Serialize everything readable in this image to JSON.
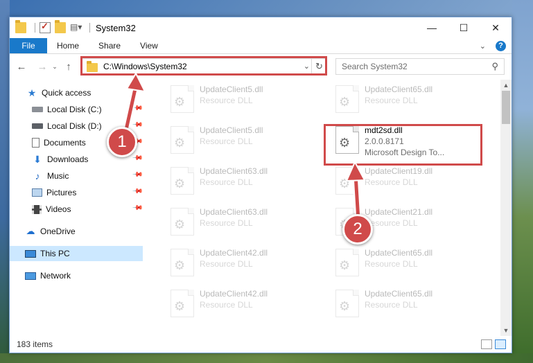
{
  "window": {
    "title": "System32",
    "controls": {
      "minimize": "—",
      "maximize": "☐",
      "close": "✕"
    }
  },
  "ribbon": {
    "tabs": [
      "File",
      "Home",
      "Share",
      "View"
    ],
    "help": "?"
  },
  "address": {
    "path": "C:\\Windows\\System32",
    "search_placeholder": "Search System32"
  },
  "sidebar": {
    "items": [
      {
        "label": "Quick access",
        "icon": "star-icon",
        "pinned": false
      },
      {
        "label": "Local Disk (C:)",
        "icon": "drive-icon",
        "pinned": true
      },
      {
        "label": "Local Disk (D:)",
        "icon": "drive-icon",
        "pinned": true
      },
      {
        "label": "Documents",
        "icon": "document-icon",
        "pinned": true
      },
      {
        "label": "Downloads",
        "icon": "download-icon",
        "pinned": true
      },
      {
        "label": "Music",
        "icon": "music-icon",
        "pinned": true
      },
      {
        "label": "Pictures",
        "icon": "pictures-icon",
        "pinned": true
      },
      {
        "label": "Videos",
        "icon": "videos-icon",
        "pinned": true
      },
      {
        "label": "OneDrive",
        "icon": "cloud-icon",
        "pinned": false
      },
      {
        "label": "This PC",
        "icon": "computer-icon",
        "pinned": false,
        "selected": true
      },
      {
        "label": "Network",
        "icon": "network-icon",
        "pinned": false
      }
    ]
  },
  "files": {
    "left": [
      {
        "name": "UpdateClient5.dll",
        "sub": "Resource DLL"
      },
      {
        "name": "UpdateClient5.dll",
        "sub": "Resource DLL"
      },
      {
        "name": "UpdateClient63.dll",
        "sub": "Resource DLL"
      },
      {
        "name": "UpdateClient63.dll",
        "sub": "Resource DLL"
      },
      {
        "name": "UpdateClient42.dll",
        "sub": "Resource DLL"
      },
      {
        "name": "UpdateClient42.dll",
        "sub": "Resource DLL"
      }
    ],
    "right": [
      {
        "name": "UpdateClient65.dll",
        "sub": "Resource DLL"
      },
      {
        "name": "mdt2sd.dll",
        "version": "2.0.0.8171",
        "sub": "Microsoft Design To...",
        "highlighted": true
      },
      {
        "name": "UpdateClient19.dll",
        "sub": "Resource DLL"
      },
      {
        "name": "UpdateClient21.dll",
        "sub": "Resource DLL"
      },
      {
        "name": "UpdateClient65.dll",
        "sub": "Resource DLL"
      },
      {
        "name": "UpdateClient65.dll",
        "sub": "Resource DLL"
      }
    ]
  },
  "status": {
    "count": "183 items"
  },
  "annotations": {
    "step1": "1",
    "step2": "2",
    "color": "#d04a4a"
  }
}
